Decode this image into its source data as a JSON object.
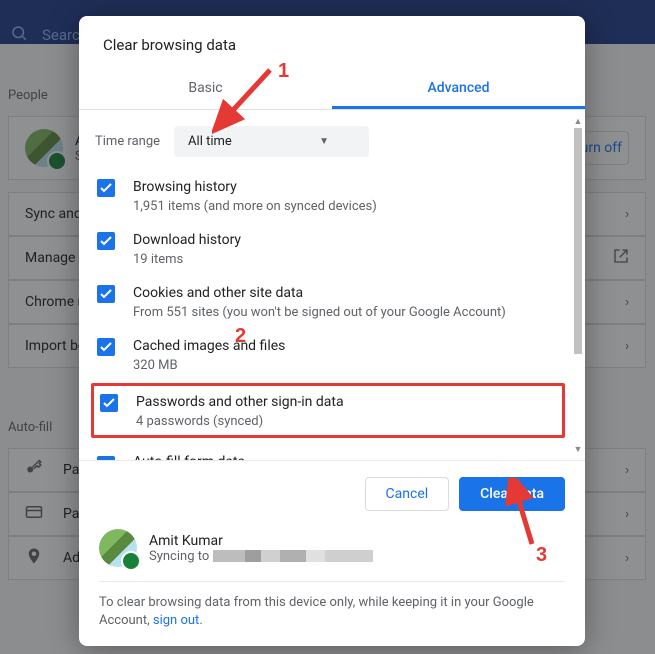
{
  "header": {
    "search_placeholder": "Search"
  },
  "page": {
    "section_people": "People",
    "section_autofill": "Auto-fill",
    "profile_name_first": "A",
    "profile_sub_first": "S",
    "turn_off": "Turn off",
    "rows": {
      "sync": "Sync and G",
      "manage": "Manage yo",
      "chrome_name": "Chrome na",
      "import": "Import boo",
      "passwords": "Pass",
      "payments": "Payn",
      "addresses": "Add"
    }
  },
  "dialog": {
    "title": "Clear browsing data",
    "tabs": {
      "basic": "Basic",
      "advanced": "Advanced"
    },
    "time_label": "Time range",
    "time_value": "All time",
    "items": [
      {
        "title": "Browsing history",
        "sub": "1,951 items (and more on synced devices)"
      },
      {
        "title": "Download history",
        "sub": "19 items"
      },
      {
        "title": "Cookies and other site data",
        "sub": "From 551 sites (you won't be signed out of your Google Account)"
      },
      {
        "title": "Cached images and files",
        "sub": "320 MB"
      },
      {
        "title": "Passwords and other sign-in data",
        "sub": "4 passwords (synced)"
      },
      {
        "title": "Auto-fill form data",
        "sub": ""
      }
    ],
    "footer": {
      "cancel": "Cancel",
      "clear": "Clear data",
      "profile_name": "Amit Kumar",
      "sync_to": "Syncing to",
      "note_pre": "To clear browsing data from this device only, while keeping it in your Google Account, ",
      "note_link": "sign out",
      "note_post": "."
    }
  },
  "annotations": {
    "n1": "1",
    "n2": "2",
    "n3": "3"
  }
}
